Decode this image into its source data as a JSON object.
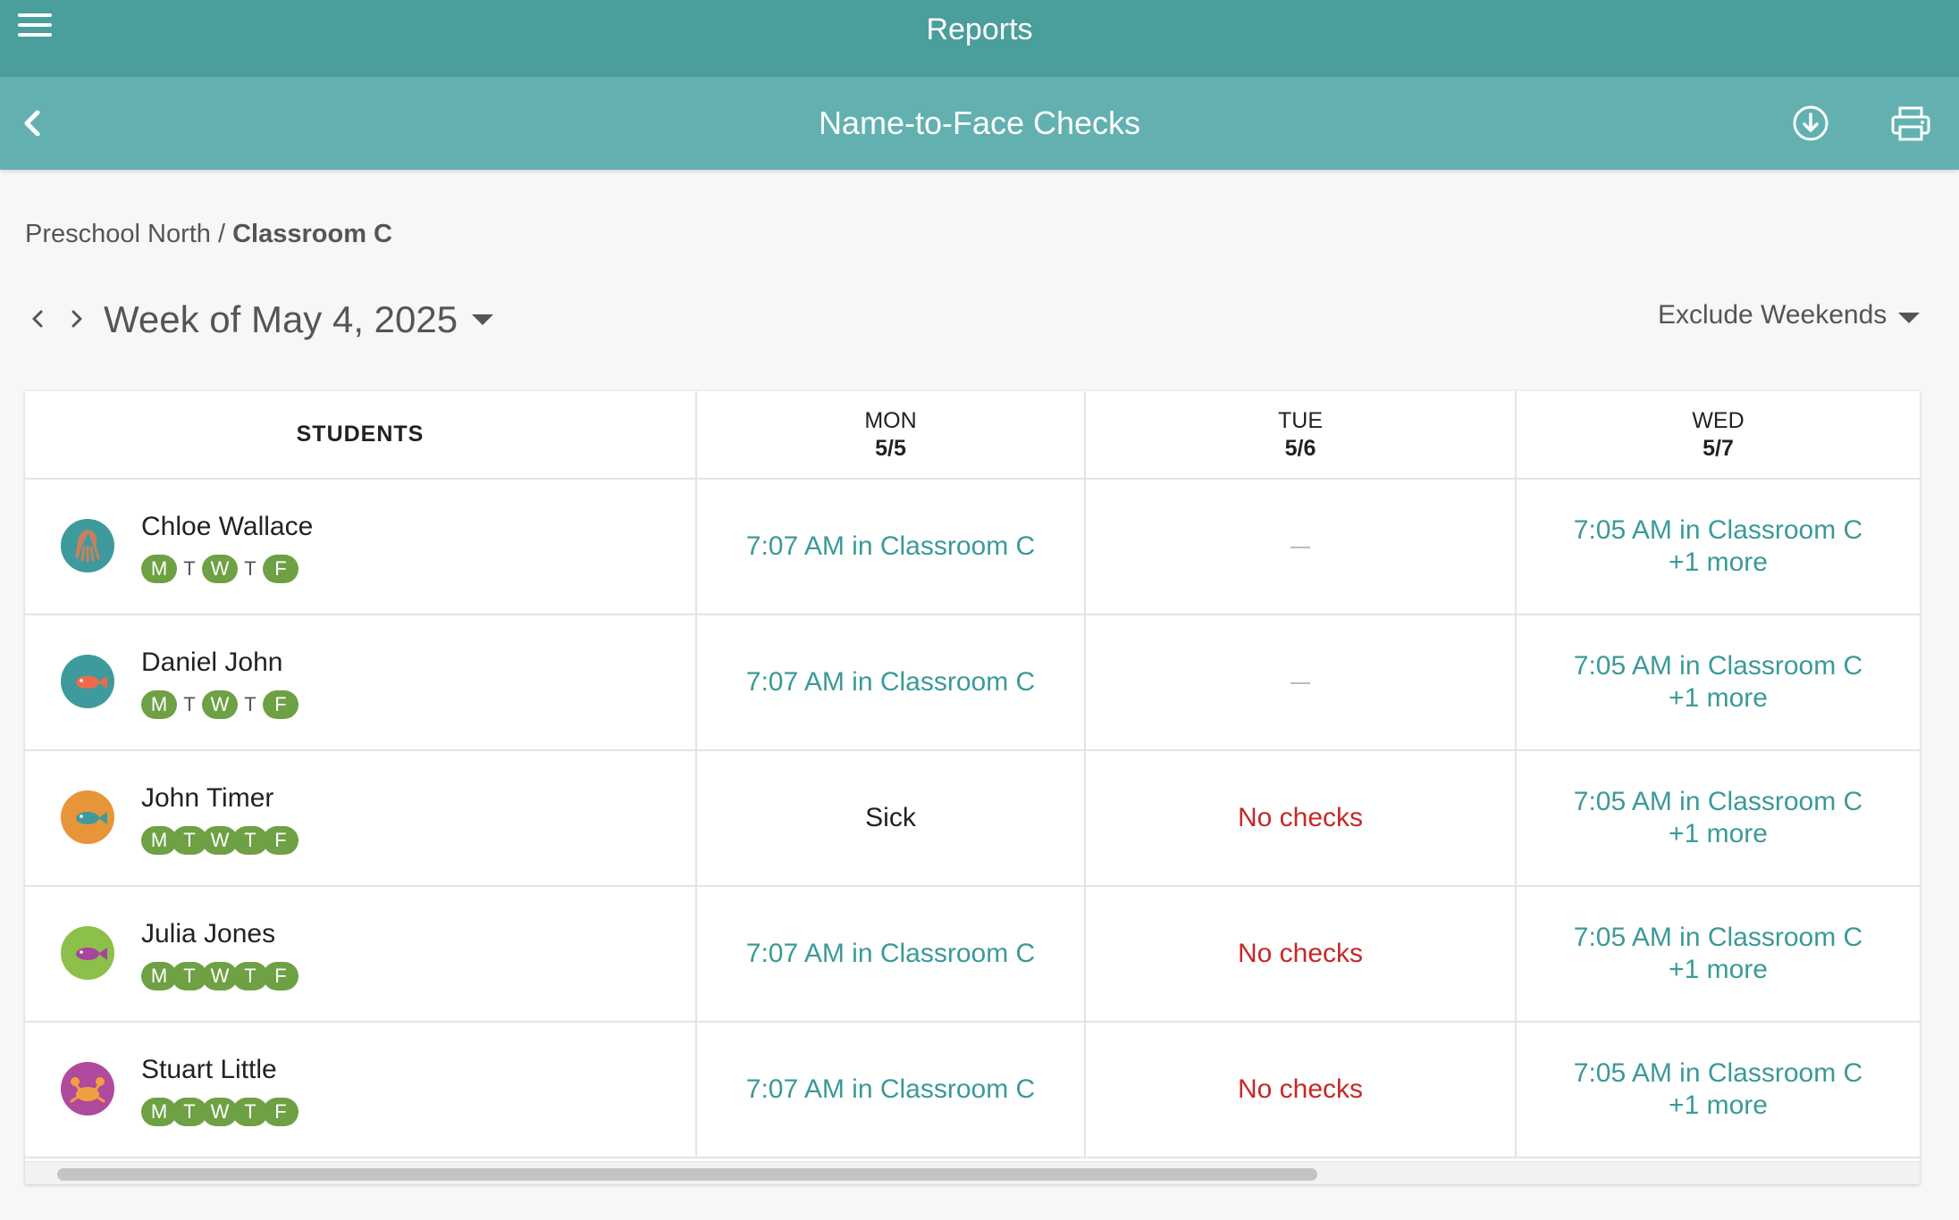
{
  "header": {
    "title": "Reports"
  },
  "subheader": {
    "title": "Name-to-Face Checks"
  },
  "breadcrumb": {
    "parent": "Preschool North",
    "separator": " / ",
    "current": "Classroom C"
  },
  "week": {
    "label": "Week of May 4, 2025"
  },
  "filter": {
    "label": "Exclude Weekends"
  },
  "table": {
    "columns": [
      {
        "label": "STUDENTS"
      },
      {
        "dow": "MON",
        "date": "5/5"
      },
      {
        "dow": "TUE",
        "date": "5/6"
      },
      {
        "dow": "WED",
        "date": "5/7"
      }
    ],
    "rows": [
      {
        "name": "Chloe Wallace",
        "avatar": {
          "icon": "octopus-icon",
          "bg": "#3e9a9c",
          "fg": "#c9805f"
        },
        "days": [
          {
            "l": "M",
            "on": true
          },
          {
            "l": "T",
            "on": false
          },
          {
            "l": "W",
            "on": true
          },
          {
            "l": "T",
            "on": false
          },
          {
            "l": "F",
            "on": true
          }
        ],
        "mon": {
          "type": "check",
          "text": "7:07 AM in Classroom C"
        },
        "tue": {
          "type": "none"
        },
        "wed": {
          "type": "check",
          "text": "7:05 AM in Classroom C",
          "more": "+1 more"
        }
      },
      {
        "name": "Daniel John",
        "avatar": {
          "icon": "fish-icon",
          "bg": "#3e9a9c",
          "fg": "#f06a4a"
        },
        "days": [
          {
            "l": "M",
            "on": true
          },
          {
            "l": "T",
            "on": false
          },
          {
            "l": "W",
            "on": true
          },
          {
            "l": "T",
            "on": false
          },
          {
            "l": "F",
            "on": true
          }
        ],
        "mon": {
          "type": "check",
          "text": "7:07 AM in Classroom C"
        },
        "tue": {
          "type": "none"
        },
        "wed": {
          "type": "check",
          "text": "7:05 AM in Classroom C",
          "more": "+1 more"
        }
      },
      {
        "name": "John Timer",
        "avatar": {
          "icon": "fish-icon",
          "bg": "#e8953a",
          "fg": "#3e9a9c"
        },
        "days": [
          {
            "l": "M",
            "on": true
          },
          {
            "l": "T",
            "on": true
          },
          {
            "l": "W",
            "on": true
          },
          {
            "l": "T",
            "on": true
          },
          {
            "l": "F",
            "on": true
          }
        ],
        "mon": {
          "type": "sick",
          "text": "Sick"
        },
        "tue": {
          "type": "nochecks",
          "text": "No checks"
        },
        "wed": {
          "type": "check",
          "text": "7:05 AM in Classroom C",
          "more": "+1 more"
        }
      },
      {
        "name": "Julia Jones",
        "avatar": {
          "icon": "fish-icon",
          "bg": "#8cc04a",
          "fg": "#a8459a"
        },
        "days": [
          {
            "l": "M",
            "on": true
          },
          {
            "l": "T",
            "on": true
          },
          {
            "l": "W",
            "on": true
          },
          {
            "l": "T",
            "on": true
          },
          {
            "l": "F",
            "on": true
          }
        ],
        "mon": {
          "type": "check",
          "text": "7:07 AM in Classroom C"
        },
        "tue": {
          "type": "nochecks",
          "text": "No checks"
        },
        "wed": {
          "type": "check",
          "text": "7:05 AM in Classroom C",
          "more": "+1 more"
        }
      },
      {
        "name": "Stuart Little",
        "avatar": {
          "icon": "crab-icon",
          "bg": "#b04a9c",
          "fg": "#f0a040"
        },
        "days": [
          {
            "l": "M",
            "on": true
          },
          {
            "l": "T",
            "on": true
          },
          {
            "l": "W",
            "on": true
          },
          {
            "l": "T",
            "on": true
          },
          {
            "l": "F",
            "on": true
          }
        ],
        "mon": {
          "type": "check",
          "text": "7:07 AM in Classroom C"
        },
        "tue": {
          "type": "nochecks",
          "text": "No checks"
        },
        "wed": {
          "type": "check",
          "text": "7:05 AM in Classroom C",
          "more": "+1 more"
        }
      }
    ]
  },
  "colors": {
    "topbar": "#4a9e9c",
    "subbar": "#62b1b0",
    "link": "#3a9a98",
    "alert": "#c62828",
    "day_on": "#6ea044"
  }
}
